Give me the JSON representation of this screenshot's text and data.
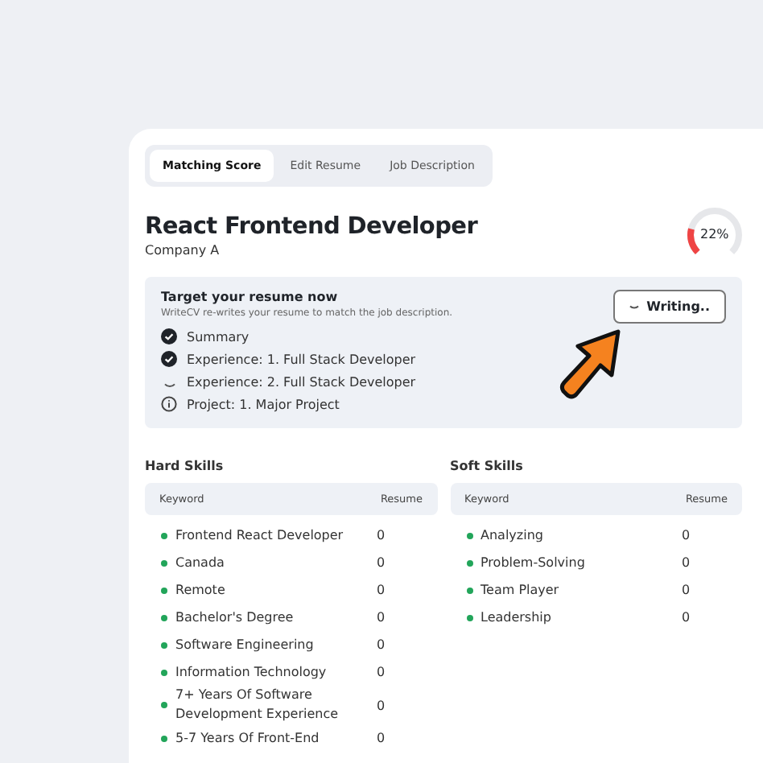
{
  "tabs": [
    {
      "label": "Matching Score",
      "selected": true
    },
    {
      "label": "Edit Resume",
      "selected": false
    },
    {
      "label": "Job Description",
      "selected": false
    }
  ],
  "job": {
    "title": "React Frontend Developer",
    "company": "Company A"
  },
  "score": {
    "label": "22%",
    "level": 0.22
  },
  "target": {
    "title": "Target your resume now",
    "description": "WriteCV re-writes your resume to match the job description.",
    "button": "Writing..",
    "items": [
      {
        "label": "Summary",
        "kind": "done"
      },
      {
        "label": "Experience: 1. Full Stack Developer",
        "kind": "done"
      },
      {
        "label": "Experience: 2. Full Stack Developer",
        "kind": "loading"
      },
      {
        "label": "Project: 1. Major Project",
        "kind": "info"
      }
    ]
  },
  "skills": [
    {
      "title": "Hard Skills",
      "columns": [
        "Keyword",
        "Resume"
      ],
      "rows": [
        {
          "keyword": "Frontend React Developer",
          "resume": "0",
          "color": "#22a55a"
        },
        {
          "keyword": "Canada",
          "resume": "0",
          "color": "#22a55a"
        },
        {
          "keyword": "Remote",
          "resume": "0",
          "color": "#22a55a"
        },
        {
          "keyword": "Bachelor's Degree",
          "resume": "0",
          "color": "#22a55a"
        },
        {
          "keyword": "Software Engineering",
          "resume": "0",
          "color": "#22a55a"
        },
        {
          "keyword": "Information Technology",
          "resume": "0",
          "color": "#22a55a"
        },
        {
          "keyword": "7+ Years Of Software Development Experience",
          "resume": "0",
          "color": "#22a55a"
        },
        {
          "keyword": "5-7 Years Of Front-End",
          "resume": "0",
          "color": "#22a55a"
        }
      ]
    },
    {
      "title": "Soft Skills",
      "columns": [
        "Keyword",
        "Resume"
      ],
      "rows": [
        {
          "keyword": "Analyzing",
          "resume": "0",
          "color": "#22a55a"
        },
        {
          "keyword": "Problem-Solving",
          "resume": "0",
          "color": "#22a55a"
        },
        {
          "keyword": "Team Player",
          "resume": "0",
          "color": "#22a55a"
        },
        {
          "keyword": "Leadership",
          "resume": "0",
          "color": "#22a55a"
        }
      ]
    }
  ]
}
